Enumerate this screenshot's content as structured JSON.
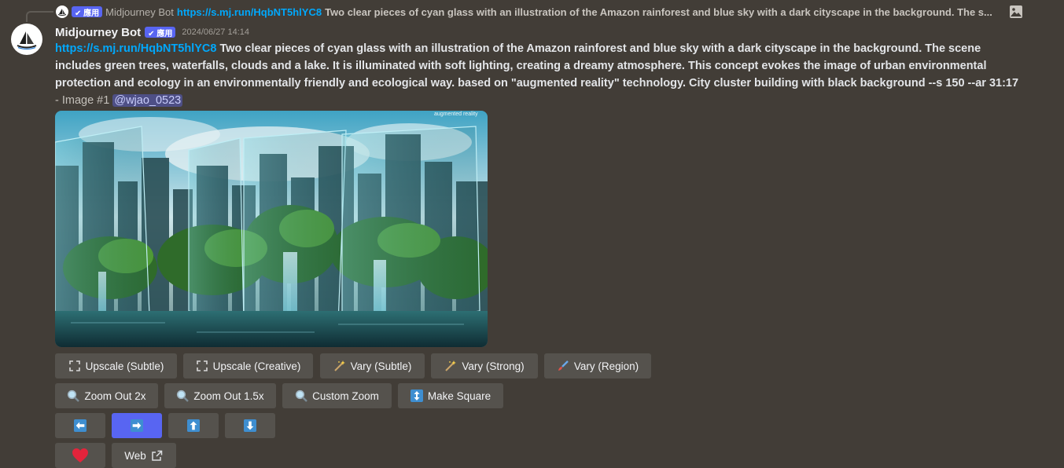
{
  "reply": {
    "author": "Midjourney Bot",
    "badge": "✔ 應用",
    "link": "https://s.mj.run/HqbNT5hlYC8",
    "text": "Two clear pieces of cyan glass with an illustration of the Amazon rainforest and blue sky with a dark cityscape in the background. The s..."
  },
  "message": {
    "author": "Midjourney Bot",
    "badge": "✔ 應用",
    "timestamp": "2024/06/27 14:14",
    "link": "https://s.mj.run/HqbNT5hlYC8",
    "prompt": "Two clear pieces of cyan glass with an illustration of the Amazon rainforest and blue sky with a dark cityscape in the background. The scene includes green trees, waterfalls, clouds and a lake. It is illuminated with soft lighting, creating a dreamy atmosphere. This concept evokes the image of urban environmental protection and ecology in an environmentally friendly and ecological way. based on \"augmented reality\" technology. City cluster building with black background --s 150 --ar 31:17",
    "meta": "- Image #1",
    "mention": "@wjao_0523",
    "image_watermark": "augmented reality"
  },
  "buttons": {
    "upscale_subtle": "Upscale (Subtle)",
    "upscale_creative": "Upscale (Creative)",
    "vary_subtle": "Vary (Subtle)",
    "vary_strong": "Vary (Strong)",
    "vary_region": "Vary (Region)",
    "zoom_out_2x": "Zoom Out 2x",
    "zoom_out_15x": "Zoom Out 1.5x",
    "custom_zoom": "Custom Zoom",
    "make_square": "Make Square",
    "web": "Web"
  },
  "colors": {
    "background": "#423d37",
    "button": "#55524d",
    "button_primary": "#5865f2",
    "link": "#00a8fc",
    "app_badge": "#5865f2",
    "mention_bg": "#4e4f86"
  },
  "icons": {
    "upscale": "expand-arrows-icon",
    "vary": "magic-wand-icon",
    "vary_region": "paintbrush-icon",
    "zoom": "magnifier-icon",
    "make_square": "up-down-arrow-icon",
    "pan_left": "arrow-left-icon",
    "pan_right": "arrow-right-icon",
    "pan_up": "arrow-up-icon",
    "pan_down": "arrow-down-icon",
    "favorite": "heart-icon",
    "web": "external-link-icon",
    "reply_image": "image-icon"
  }
}
